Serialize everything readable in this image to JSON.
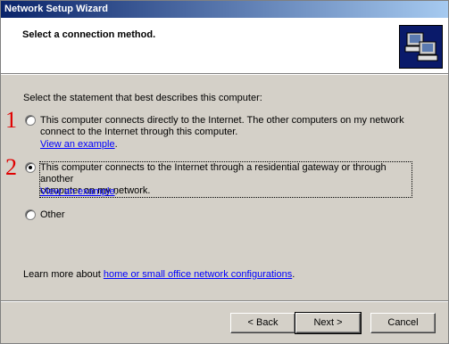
{
  "window": {
    "title": "Network Setup Wizard"
  },
  "header": {
    "heading": "Select a connection method.",
    "image_icon": "network-computers-icon"
  },
  "instruction": "Select the statement that best describes this computer:",
  "options": [
    {
      "marker": "1",
      "text_line1": "This computer connects directly to the Internet. The other computers on my network",
      "text_line2": "connect to the Internet through this computer.",
      "link": "View an example",
      "link_suffix": ".",
      "selected": false
    },
    {
      "marker": "2",
      "text_line1": "This computer connects to the Internet through a residential gateway or through another",
      "text_line2": "computer on my network.",
      "link": "View an example",
      "link_suffix": ".",
      "selected": true
    },
    {
      "label": "Other",
      "selected": false
    }
  ],
  "learn_more": {
    "prefix": "Learn more about ",
    "link": "home or small office network configurations",
    "suffix": "."
  },
  "buttons": {
    "back": "< Back",
    "next": "Next >",
    "cancel": "Cancel"
  },
  "colors": {
    "title_start": "#0a246a",
    "title_end": "#a6caf0",
    "marker": "#e00000",
    "link": "#0000ff"
  }
}
